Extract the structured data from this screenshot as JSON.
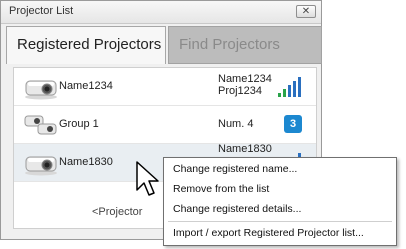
{
  "window": {
    "title": "Projector List",
    "close_label": "✕"
  },
  "tabs": [
    {
      "label": "Registered Projectors",
      "active": true
    },
    {
      "label": "Find Projectors",
      "active": false
    }
  ],
  "projectors": [
    {
      "name": "Name1234",
      "detail_line1": "Name1234",
      "detail_line2": "Proj1234",
      "icon": "projector-icon",
      "status": "signal-icon"
    },
    {
      "name": "Group 1",
      "detail_line1": "Num. 4",
      "icon": "projector-group-icon",
      "badge": "3"
    },
    {
      "name": "Name1830",
      "detail_line1": "Name1830",
      "icon": "projector-icon",
      "status": "signal-icon"
    }
  ],
  "list_placeholder": "<Projector",
  "context_menu": {
    "items": [
      "Change registered name...",
      "Remove from the list",
      "Change registered details...",
      "Import / export Registered Projector list..."
    ]
  },
  "colors": {
    "accent": "#1c88d0",
    "signal_green": "#2aa34a",
    "signal_blue": "#2a6fbf",
    "selected_row": "#e9eef2",
    "inactive_tab": "#bcbcbc"
  }
}
